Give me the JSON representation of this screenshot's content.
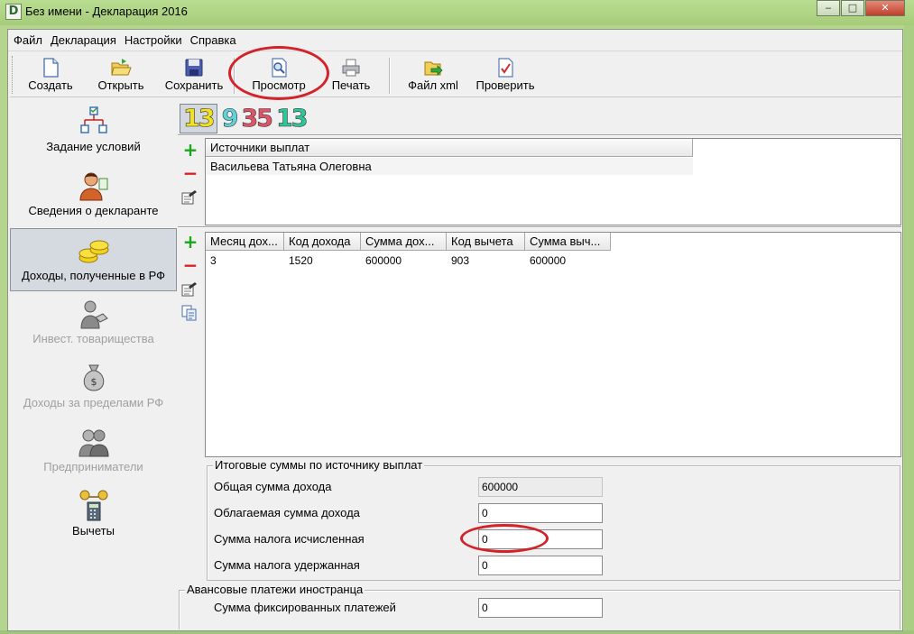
{
  "window": {
    "app_icon": "D",
    "title": "Без имени - Декларация 2016",
    "buttons": {
      "minimize": "‒",
      "maximize": "□",
      "close": "✕"
    }
  },
  "menu": [
    "Файл",
    "Декларация",
    "Настройки",
    "Справка"
  ],
  "toolbar": [
    {
      "label": "Создать",
      "icon": "new-document-icon"
    },
    {
      "label": "Открыть",
      "icon": "open-folder-icon"
    },
    {
      "label": "Сохранить",
      "icon": "save-disk-icon"
    },
    {
      "label": "Просмотр",
      "icon": "preview-icon"
    },
    {
      "label": "Печать",
      "icon": "printer-icon"
    },
    {
      "label": "Файл xml",
      "icon": "xml-export-icon"
    },
    {
      "label": "Проверить",
      "icon": "check-document-icon"
    }
  ],
  "sidebar": [
    {
      "label": "Задание условий",
      "icon": "conditions-tree-icon",
      "state": "normal"
    },
    {
      "label": "Сведения о декларанте",
      "icon": "person-icon",
      "state": "normal"
    },
    {
      "label": "Доходы, полученные в РФ",
      "icon": "coins-icon",
      "state": "selected"
    },
    {
      "label": "Инвест. товарищества",
      "icon": "handshake-icon",
      "state": "disabled"
    },
    {
      "label": "Доходы за пределами РФ",
      "icon": "money-bag-icon",
      "state": "disabled"
    },
    {
      "label": "Предприниматели",
      "icon": "businessmen-icon",
      "state": "disabled"
    },
    {
      "label": "Вычеты",
      "icon": "scales-calculator-icon",
      "state": "normal"
    }
  ],
  "rate_tabs": [
    {
      "label": "13",
      "color": "#f2e21c",
      "selected": true
    },
    {
      "label": "9",
      "color": "#5fd3d8",
      "selected": false
    },
    {
      "label": "35",
      "color": "#e0546a",
      "selected": false
    },
    {
      "label": "13",
      "color": "#2fc59a",
      "selected": false
    }
  ],
  "sources": {
    "header": "Источники выплат",
    "rows": [
      "Васильева Татьяна Олеговна"
    ]
  },
  "income": {
    "headers": [
      "Месяц дох...",
      "Код дохода",
      "Сумма дох...",
      "Код вычета",
      "Сумма выч..."
    ],
    "rows": [
      [
        "3",
        "1520",
        "600000",
        "903",
        "600000"
      ]
    ]
  },
  "totals": {
    "title": "Итоговые суммы по источнику выплат",
    "fields": [
      {
        "label": "Общая сумма дохода",
        "value": "600000",
        "readonly": true
      },
      {
        "label": "Облагаемая сумма дохода",
        "value": "0",
        "readonly": false
      },
      {
        "label": "Сумма налога исчисленная",
        "value": "0",
        "readonly": false
      },
      {
        "label": "Сумма налога удержанная",
        "value": "0",
        "readonly": false
      }
    ]
  },
  "advance": {
    "title": "Авансовые платежи иностранца",
    "fields": [
      {
        "label": "Сумма фиксированных платежей",
        "value": "0"
      }
    ]
  },
  "colors": {
    "accent_green": "#1aa51a",
    "remove_red": "#d81e1e",
    "annotation_red": "#d2232a",
    "titlebar": "#b5d58e"
  }
}
